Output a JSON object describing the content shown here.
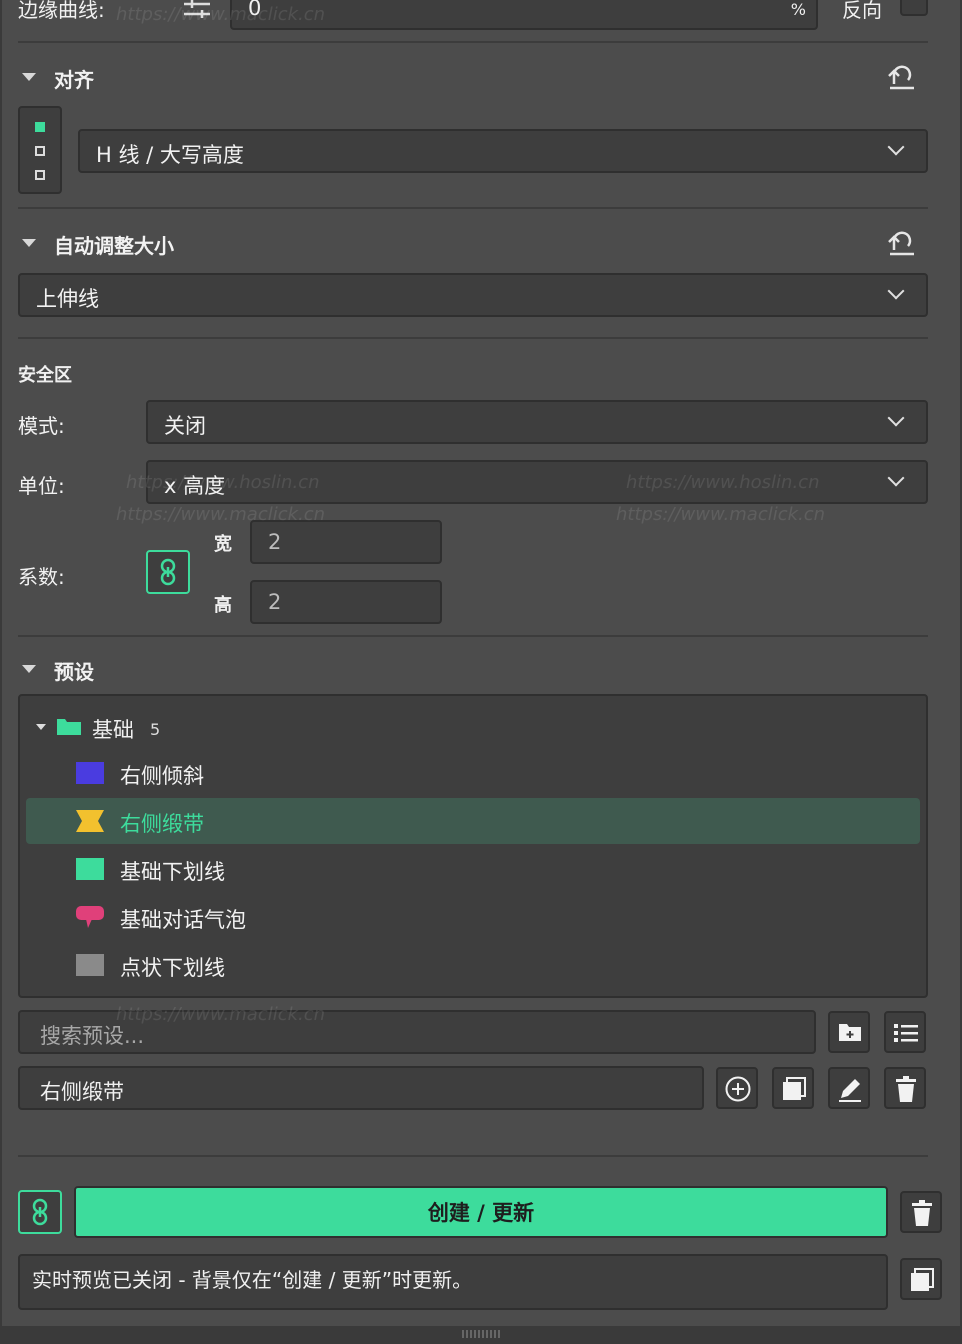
{
  "top": {
    "edge_label": "边缘曲线:",
    "edge_value": "0",
    "percent": "%",
    "reverse_label": "反向"
  },
  "align": {
    "title": "对齐",
    "select_value": "H 线 / 大写高度"
  },
  "autosize": {
    "title": "自动调整大小",
    "select_value": "上伸线"
  },
  "safezone": {
    "title": "安全区",
    "mode_label": "模式:",
    "mode_value": "关闭",
    "unit_label": "单位:",
    "unit_value": "x 高度",
    "factor_label": "系数:",
    "width_label": "宽",
    "width_value": "2",
    "height_label": "高",
    "height_value": "2"
  },
  "presets": {
    "title": "预设",
    "folder_name": "基础",
    "folder_count": "5",
    "items": [
      {
        "label": "右侧倾斜",
        "color": "#4a3ce0",
        "selected": false
      },
      {
        "label": "右侧缎带",
        "color": "#f2c12e",
        "selected": true
      },
      {
        "label": "基础下划线",
        "color": "#3ddc9c",
        "selected": false
      },
      {
        "label": "基础对话气泡",
        "color": "#e0407a",
        "selected": false
      },
      {
        "label": "点状下划线",
        "color": "#8a8a8a",
        "selected": false
      }
    ],
    "search_placeholder": "搜索预设...",
    "name_value": "右侧缎带"
  },
  "footer": {
    "create_label": "创建 / 更新",
    "status_text": "实时预览已关闭 - 背景仅在“创建 / 更新”时更新。"
  },
  "colors": {
    "accent": "#3ddc9c",
    "selected_row": "#3f5a4f",
    "selected_text": "#3ddc9c"
  },
  "watermarks": {
    "a": "https://www.maclick.cn",
    "b": "https://www.hoslin.cn",
    "c": "https://www.maclick.cn",
    "d": "https://www.hoslin.cn",
    "e": "https://www.maclick.cn",
    "f": "https://www.maclick.cn"
  }
}
